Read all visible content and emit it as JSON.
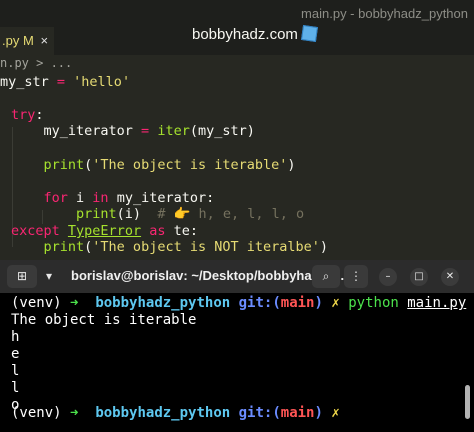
{
  "window": {
    "title": "main.py - bobbyhadz_python"
  },
  "tab": {
    "name": ".py",
    "status": "M",
    "close": "×"
  },
  "watermark": {
    "text": "bobbyhadz.com"
  },
  "breadcrumb": {
    "text": "n.py > ..."
  },
  "code": {
    "l1": {
      "var": "my_str",
      "eq": " = ",
      "val": "'hello'"
    },
    "l2": {
      "kw": "try",
      "colon": ":"
    },
    "l3": {
      "var": "    my_iterator",
      "eq": " = ",
      "fn": "iter",
      "args": "(my_str)"
    },
    "l4": {
      "fn": "    print",
      "open": "(",
      "str": "'The object is iterable'",
      "close": ")"
    },
    "l5": {
      "kw1": "    for",
      "var": " i ",
      "kw2": "in",
      "rest": " my_iterator:"
    },
    "l6": {
      "fn": "        print",
      "args": "(i)",
      "cmt": "  # 👉 h, e, l, l, o"
    },
    "l7": {
      "kw1": "except",
      "cls": "TypeError",
      "kw2": "as",
      "rest": " te:"
    },
    "l8": {
      "fn": "    print",
      "open": "(",
      "str": "'The object is NOT iteralbe'",
      "close": ")"
    }
  },
  "terminal": {
    "title": "borislav@borislav: ~/Desktop/bobbyhadz_...",
    "buttons": {
      "new_tab_icon": "⊞",
      "dropdown": "▾",
      "search": "⌕",
      "menu": "⋮",
      "minimize": "–",
      "maximize": "□",
      "close": "✕"
    },
    "prompt": {
      "venv": "(venv)",
      "arrow": "➜",
      "dir": "bobbyhadz_python",
      "git": "git:(",
      "branch": "main",
      "git_close": ")",
      "x": "✗"
    },
    "cmd": {
      "python": "python",
      "file": "main.py"
    },
    "output": [
      "The object is iterable",
      "h",
      "e",
      "l",
      "l",
      "o"
    ]
  }
}
